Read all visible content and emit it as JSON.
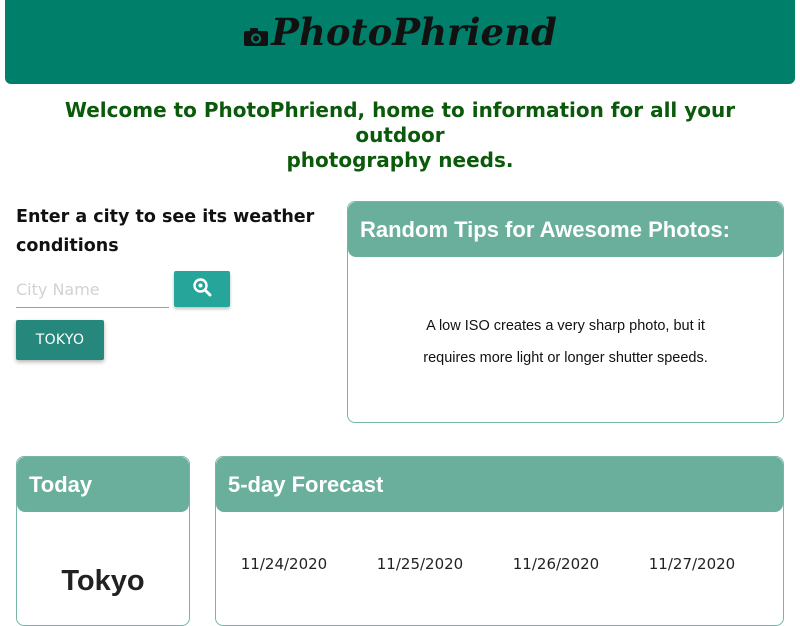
{
  "header": {
    "brand": "PhotoPhriend",
    "icon": "camera-icon"
  },
  "welcome": {
    "line1": "Welcome to PhotoPhriend, home to information for all your outdoor",
    "line2": "photography needs."
  },
  "search": {
    "prompt_line1": "Enter a city to see its weather",
    "prompt_line2": "conditions",
    "placeholder": "City Name",
    "button_icon": "search-icon",
    "history": [
      "TOKYO"
    ]
  },
  "tips": {
    "title": "Random Tips for Awesome Photos:",
    "line1": "A low ISO creates a very sharp photo, but it",
    "line2": "requires more light or longer shutter speeds."
  },
  "today": {
    "title": "Today",
    "city": "Tokyo"
  },
  "forecast": {
    "title": "5-day Forecast",
    "dates": [
      "11/24/2020",
      "11/25/2020",
      "11/26/2020",
      "11/27/2020"
    ]
  },
  "colors": {
    "header_bg": "#00806b",
    "card_header_bg": "#6aaf9b",
    "button_bg": "#26a69a",
    "welcome_text": "#0b5a0b"
  }
}
